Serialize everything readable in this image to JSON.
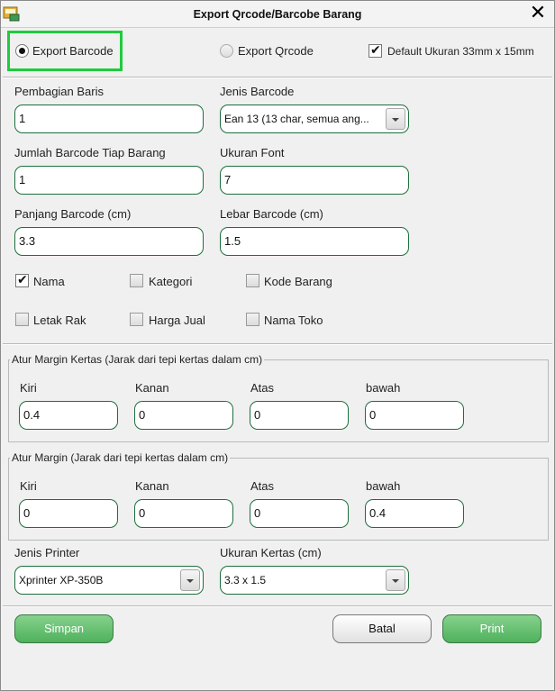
{
  "window": {
    "title": "Export Qrcode/Barcobe Barang",
    "close_label": "✕"
  },
  "export_mode": {
    "barcode_label": "Export Barcode",
    "barcode_selected": true,
    "qrcode_label": "Export Qrcode",
    "qrcode_selected": false,
    "default_size_label": "Default Ukuran 33mm x 15mm",
    "default_size_checked": true
  },
  "fields": {
    "pembagian_baris": {
      "label": "Pembagian Baris",
      "value": "1"
    },
    "jenis_barcode": {
      "label": "Jenis Barcode",
      "value": "Ean 13 (13 char, semua ang..."
    },
    "jumlah_barcode": {
      "label": "Jumlah Barcode Tiap Barang",
      "value": "1"
    },
    "ukuran_font": {
      "label": "Ukuran Font",
      "value": "7"
    },
    "panjang_barcode": {
      "label": "Panjang Barcode (cm)",
      "value": "3.3"
    },
    "lebar_barcode": {
      "label": "Lebar Barcode (cm)",
      "value": "1.5"
    }
  },
  "options": {
    "nama": {
      "label": "Nama",
      "checked": true
    },
    "kategori": {
      "label": "Kategori",
      "checked": false
    },
    "kode_barang": {
      "label": "Kode Barang",
      "checked": false
    },
    "letak_rak": {
      "label": "Letak Rak",
      "checked": false
    },
    "harga_jual": {
      "label": "Harga Jual",
      "checked": false
    },
    "nama_toko": {
      "label": "Nama Toko",
      "checked": false
    },
    "check_glyph": "✔"
  },
  "margin_kertas": {
    "title": "Atur Margin Kertas (Jarak dari tepi kertas dalam cm)",
    "kiri_label": "Kiri",
    "kiri_value": "0.4",
    "kanan_label": "Kanan",
    "kanan_value": "0",
    "atas_label": "Atas",
    "atas_value": "0",
    "bawah_label": "bawah",
    "bawah_value": "0"
  },
  "margin": {
    "title": "Atur Margin (Jarak dari tepi kertas dalam cm)",
    "kiri_label": "Kiri",
    "kiri_value": "0",
    "kanan_label": "Kanan",
    "kanan_value": "0",
    "atas_label": "Atas",
    "atas_value": "0",
    "bawah_label": "bawah",
    "bawah_value": "0.4"
  },
  "printer": {
    "jenis_label": "Jenis Printer",
    "jenis_value": "Xprinter XP-350B",
    "ukuran_label": "Ukuran Kertas (cm)",
    "ukuran_value": "3.3 x 1.5"
  },
  "buttons": {
    "simpan": "Simpan",
    "batal": "Batal",
    "print": "Print"
  },
  "colors": {
    "highlight": "#1fcb3c",
    "input_border": "#1d6f3d",
    "button_green": "#4fb15c"
  },
  "icons": {
    "app": "barcode-app-icon",
    "close": "close-icon",
    "dropdown": "chevron-down-icon",
    "check": "checkmark-icon"
  }
}
